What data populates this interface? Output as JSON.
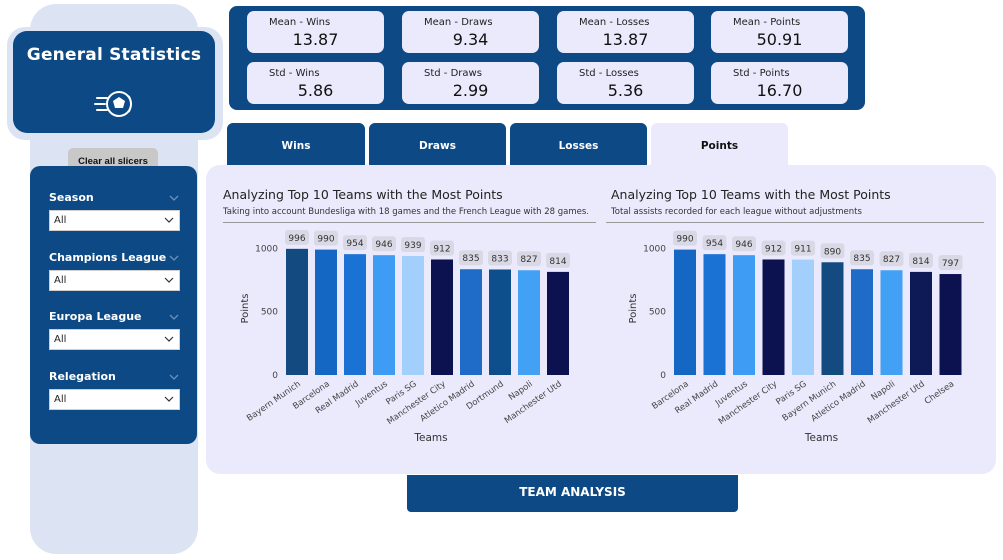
{
  "sidebar": {
    "title": "General Statistics",
    "clear_button": "Clear all slicers",
    "slicers": [
      {
        "label": "Season",
        "value": "All"
      },
      {
        "label": "Champions League",
        "value": "All"
      },
      {
        "label": "Europa League",
        "value": "All"
      },
      {
        "label": "Relegation",
        "value": "All"
      }
    ]
  },
  "kpis": [
    {
      "label": "Mean - Wins",
      "value": "13.87"
    },
    {
      "label": "Mean - Draws",
      "value": "9.34"
    },
    {
      "label": "Mean - Losses",
      "value": "13.87"
    },
    {
      "label": "Mean - Points",
      "value": "50.91"
    },
    {
      "label": "Std - Wins",
      "value": "5.86"
    },
    {
      "label": "Std - Draws",
      "value": "2.99"
    },
    {
      "label": "Std - Losses",
      "value": "5.36"
    },
    {
      "label": "Std - Points",
      "value": "16.70"
    }
  ],
  "tabs": [
    {
      "label": "Wins",
      "active": false
    },
    {
      "label": "Draws",
      "active": false
    },
    {
      "label": "Losses",
      "active": false
    },
    {
      "label": "Points",
      "active": true
    }
  ],
  "charts": [
    {
      "title": "Analyzing Top 10 Teams with the Most Points",
      "subtitle": "Taking into account Bundesliga with 18 games and the French League with 28 games..."
    },
    {
      "title": "Analyzing Top 10 Teams with the Most Points",
      "subtitle": "Total assists recorded for each league without adjustments"
    }
  ],
  "chart_data": [
    {
      "type": "bar",
      "title": "Analyzing Top 10 Teams with the Most Points",
      "subtitle": "Taking into account Bundesliga with 18 games and the French League with 28 games...",
      "xlabel": "Teams",
      "ylabel": "Points",
      "ylim": [
        0,
        1050
      ],
      "yticks": [
        0,
        500,
        1000
      ],
      "grid": false,
      "categories": [
        "Bayern Munich",
        "Barcelona",
        "Real Madrid",
        "Juventus",
        "Paris SG",
        "Manchester City",
        "Atletico Madrid",
        "Dortmund",
        "Napoli",
        "Manchester Utd"
      ],
      "values": [
        996,
        990,
        954,
        946,
        939,
        912,
        835,
        833,
        827,
        814
      ],
      "colors": [
        "#134a80",
        "#1468c4",
        "#1a72d4",
        "#3f9cf4",
        "#a2cffb",
        "#0c1150",
        "#1f6bc8",
        "#0d4e8c",
        "#42a0f5",
        "#0c1150"
      ]
    },
    {
      "type": "bar",
      "title": "Analyzing Top 10 Teams with the Most Points",
      "subtitle": "Total assists recorded for each league without adjustments",
      "xlabel": "Teams",
      "ylabel": "Points",
      "ylim": [
        0,
        1050
      ],
      "yticks": [
        0,
        500,
        1000
      ],
      "grid": false,
      "categories": [
        "Barcelona",
        "Real Madrid",
        "Juventus",
        "Manchester City",
        "Paris SG",
        "Bayern Munich",
        "Atletico Madrid",
        "Napoli",
        "Manchester Utd",
        "Chelsea"
      ],
      "values": [
        990,
        954,
        946,
        912,
        911,
        890,
        835,
        827,
        814,
        797
      ],
      "colors": [
        "#1468c4",
        "#1a72d4",
        "#3f9cf4",
        "#0c1150",
        "#a2cffb",
        "#134a80",
        "#1f6bc8",
        "#42a0f5",
        "#0d1a55",
        "#0c1150"
      ]
    }
  ],
  "footer": {
    "button": "TEAM ANALYSIS"
  }
}
